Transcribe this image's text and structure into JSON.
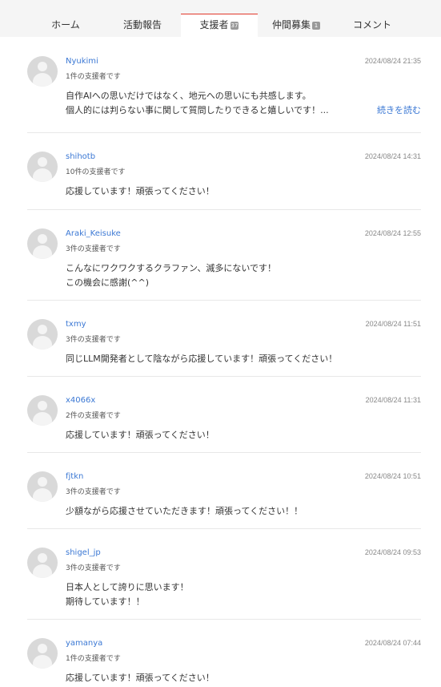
{
  "tabs": [
    {
      "label": "ホーム"
    },
    {
      "label": "活動報告"
    },
    {
      "label": "支援者",
      "badge": "37",
      "active": true
    },
    {
      "label": "仲間募集",
      "badge": "1"
    },
    {
      "label": "コメント"
    }
  ],
  "comments": [
    {
      "user": "Nyukimi",
      "support": "1件の支援者です",
      "date": "2024/08/24 21:35",
      "lines": [
        "自作AIへの思いだけではなく、地元への思いにも共感します。",
        "個人的には判らない事に関して質問したりできると嬉しいです！..."
      ],
      "more": "続きを読む"
    },
    {
      "user": "shihotb",
      "support": "10件の支援者です",
      "date": "2024/08/24 14:31",
      "lines": [
        "応援しています！頑張ってください！"
      ]
    },
    {
      "user": "Araki_Keisuke",
      "support": "3件の支援者です",
      "date": "2024/08/24 12:55",
      "lines": [
        "こんなにワクワクするクラファン、滅多にないです！",
        "この機会に感謝(^^)"
      ]
    },
    {
      "user": "txmy",
      "support": "3件の支援者です",
      "date": "2024/08/24 11:51",
      "lines": [
        "同じLLM開発者として陰ながら応援しています！頑張ってください！"
      ]
    },
    {
      "user": "x4066x",
      "support": "2件の支援者です",
      "date": "2024/08/24 11:31",
      "lines": [
        "応援しています！頑張ってください！"
      ]
    },
    {
      "user": "fjtkn",
      "support": "3件の支援者です",
      "date": "2024/08/24 10:51",
      "lines": [
        "少額ながら応援させていただきます！頑張ってください！！"
      ]
    },
    {
      "user": "shigel_jp",
      "support": "3件の支援者です",
      "date": "2024/08/24 09:53",
      "lines": [
        "日本人として誇りに思います！",
        "期待しています！！"
      ]
    },
    {
      "user": "yamanya",
      "support": "1件の支援者です",
      "date": "2024/08/24 07:44",
      "lines": [
        "応援しています！頑張ってください！"
      ]
    }
  ]
}
